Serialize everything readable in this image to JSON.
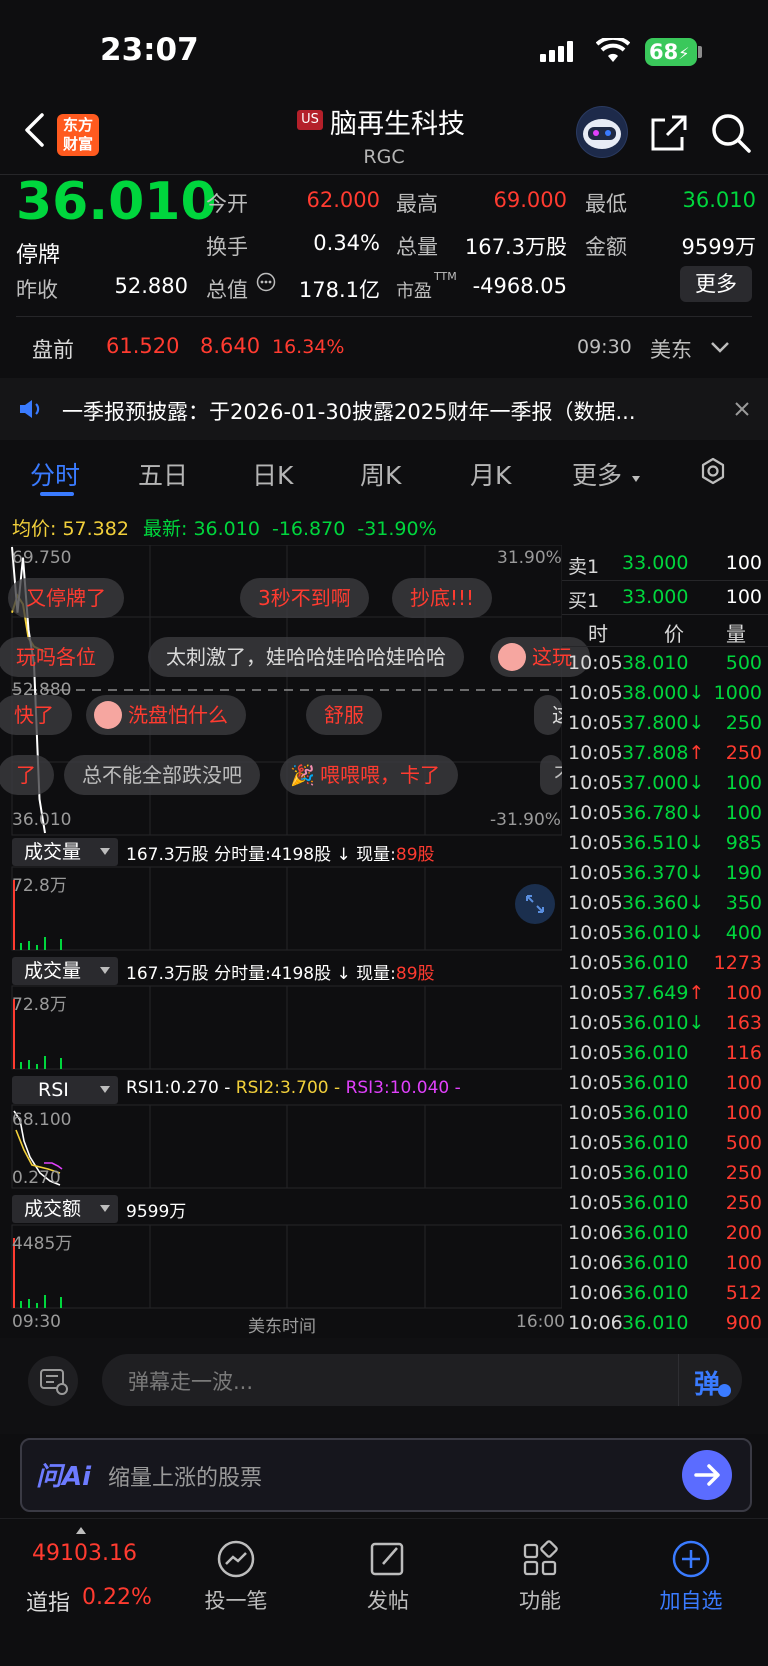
{
  "status_bar": {
    "time": "23:07",
    "battery": "68"
  },
  "header": {
    "market_badge": "US",
    "stock_name": "脑再生科技",
    "ticker": "RGC",
    "logo_text": "东方财富"
  },
  "quote": {
    "price": "36.010",
    "status": "停牌",
    "open_label": "今开",
    "open": "62.000",
    "high_label": "最高",
    "high": "69.000",
    "low_label": "最低",
    "low": "36.010",
    "turnover_label": "换手",
    "turnover": "0.34%",
    "volume_label": "总量",
    "volume": "167.3万股",
    "amount_label": "金额",
    "amount": "9599万",
    "prev_close_label": "昨收",
    "prev_close": "52.880",
    "mkt_cap_label": "总值",
    "mkt_cap": "178.1亿",
    "pe_label": "市盈",
    "pe_sup": "TTM",
    "pe": "-4968.05",
    "more_button": "更多"
  },
  "premarket": {
    "label": "盘前",
    "price": "61.520",
    "change": "8.640",
    "pct": "16.34%",
    "time": "09:30",
    "zone": "美东"
  },
  "notice": {
    "text": "一季报预披露：于2026-01-30披露2025财年一季报（数据..."
  },
  "tabs": [
    {
      "label": "分时"
    },
    {
      "label": "五日"
    },
    {
      "label": "日K"
    },
    {
      "label": "周K"
    },
    {
      "label": "月K"
    },
    {
      "label": "更多"
    }
  ],
  "chart": {
    "avg_label": "均价:",
    "avg": "57.382",
    "latest_label": "最新:",
    "latest": "36.010",
    "change": "-16.870",
    "pct": "-31.90%",
    "y_top": "69.750",
    "y_mid": "52.880",
    "y_bot": "36.010",
    "pct_top": "31.90%",
    "pct_bot": "-31.90%",
    "x_start": "09:30",
    "x_mid": "美东时间",
    "x_end": "16:00",
    "price_line": [
      [
        0,
        69.75
      ],
      [
        0.01,
        62.0
      ],
      [
        0.02,
        68.5
      ],
      [
        0.03,
        60.0
      ],
      [
        0.04,
        56.0
      ],
      [
        0.05,
        40.0
      ],
      [
        0.06,
        36.01
      ]
    ],
    "avg_line": [
      [
        0,
        62.0
      ],
      [
        0.01,
        64.0
      ],
      [
        0.02,
        63.0
      ],
      [
        0.03,
        59.0
      ],
      [
        0.04,
        58.0
      ],
      [
        0.06,
        57.382
      ]
    ]
  },
  "panels": {
    "vol1": {
      "selector": "成交量",
      "total": "167.3万股",
      "min_label": "分时量:",
      "min_vol": "4198股",
      "cur_label": "现量:",
      "cur_vol": "89股",
      "ymax": "72.8万"
    },
    "vol2": {
      "selector": "成交量",
      "total": "167.3万股",
      "min_label": "分时量:",
      "min_vol": "4198股",
      "cur_label": "现量:",
      "cur_vol": "89股",
      "ymax": "72.8万"
    },
    "rsi": {
      "selector": "RSI",
      "rsi1": "RSI1:0.270",
      "rsi2": "RSI2:3.700",
      "rsi3": "RSI3:10.040",
      "ymax": "68.100",
      "ymin": "0.270"
    },
    "amt": {
      "selector": "成交额",
      "total": "9599万",
      "ymax": "4485万"
    }
  },
  "danmaku": [
    {
      "text": "又停牌了"
    },
    {
      "text": "3秒不到啊"
    },
    {
      "text": "抄底!!!"
    },
    {
      "text": "玩吗各位"
    },
    {
      "text": "太刺激了，娃哈哈娃哈哈娃哈哈"
    },
    {
      "text": "这玩"
    },
    {
      "text": "快了"
    },
    {
      "text": "洗盘怕什么"
    },
    {
      "text": "舒服"
    },
    {
      "text": "这"
    },
    {
      "text": "了"
    },
    {
      "text": "总不能全部跌没吧"
    },
    {
      "text": "喂喂喂，卡了"
    },
    {
      "text": "不"
    }
  ],
  "orderbook": {
    "ask_label": "卖1",
    "ask_price": "33.000",
    "ask_vol": "100",
    "bid_label": "买1",
    "bid_price": "33.000",
    "bid_vol": "100",
    "col_time": "时",
    "col_price": "价",
    "col_vol": "量"
  },
  "ticks": [
    {
      "t": "10:05",
      "p": "38.010",
      "v": "500",
      "pc": "#00d63d",
      "vc": "#00d63d"
    },
    {
      "t": "10:05",
      "p": "38.000↓",
      "v": "1000",
      "pc": "#00d63d",
      "vc": "#00d63d"
    },
    {
      "t": "10:05",
      "p": "37.800↓",
      "v": "250",
      "pc": "#00d63d",
      "vc": "#00d63d"
    },
    {
      "t": "10:05",
      "p": "37.808↑",
      "v": "250",
      "pc": "#00d63d",
      "vc": "#ff3b30",
      "arrow": "red"
    },
    {
      "t": "10:05",
      "p": "37.000↓",
      "v": "100",
      "pc": "#00d63d",
      "vc": "#00d63d"
    },
    {
      "t": "10:05",
      "p": "36.780↓",
      "v": "100",
      "pc": "#00d63d",
      "vc": "#00d63d"
    },
    {
      "t": "10:05",
      "p": "36.510↓",
      "v": "985",
      "pc": "#00d63d",
      "vc": "#00d63d"
    },
    {
      "t": "10:05",
      "p": "36.370↓",
      "v": "190",
      "pc": "#00d63d",
      "vc": "#00d63d"
    },
    {
      "t": "10:05",
      "p": "36.360↓",
      "v": "350",
      "pc": "#00d63d",
      "vc": "#00d63d"
    },
    {
      "t": "10:05",
      "p": "36.010↓",
      "v": "400",
      "pc": "#00d63d",
      "vc": "#00d63d"
    },
    {
      "t": "10:05",
      "p": "36.010",
      "v": "1273",
      "pc": "#00d63d",
      "vc": "#ff3b30"
    },
    {
      "t": "10:05",
      "p": "37.649↑",
      "v": "100",
      "pc": "#00d63d",
      "vc": "#ff3b30",
      "arrow": "red"
    },
    {
      "t": "10:05",
      "p": "36.010↓",
      "v": "163",
      "pc": "#00d63d",
      "vc": "#ff3b30"
    },
    {
      "t": "10:05",
      "p": "36.010",
      "v": "116",
      "pc": "#00d63d",
      "vc": "#ff3b30"
    },
    {
      "t": "10:05",
      "p": "36.010",
      "v": "100",
      "pc": "#00d63d",
      "vc": "#ff3b30"
    },
    {
      "t": "10:05",
      "p": "36.010",
      "v": "100",
      "pc": "#00d63d",
      "vc": "#ff3b30"
    },
    {
      "t": "10:05",
      "p": "36.010",
      "v": "500",
      "pc": "#00d63d",
      "vc": "#ff3b30"
    },
    {
      "t": "10:05",
      "p": "36.010",
      "v": "250",
      "pc": "#00d63d",
      "vc": "#ff3b30"
    },
    {
      "t": "10:05",
      "p": "36.010",
      "v": "250",
      "pc": "#00d63d",
      "vc": "#ff3b30"
    },
    {
      "t": "10:06",
      "p": "36.010",
      "v": "200",
      "pc": "#00d63d",
      "vc": "#ff3b30"
    },
    {
      "t": "10:06",
      "p": "36.010",
      "v": "100",
      "pc": "#00d63d",
      "vc": "#ff3b30"
    },
    {
      "t": "10:06",
      "p": "36.010",
      "v": "512",
      "pc": "#00d63d",
      "vc": "#ff3b30"
    },
    {
      "t": "10:06",
      "p": "36.010",
      "v": "900",
      "pc": "#00d63d",
      "vc": "#ff3b30"
    }
  ],
  "input": {
    "placeholder": "弹幕走一波...",
    "send_label": "弹"
  },
  "askai": {
    "brand": "问Ai",
    "query": "缩量上涨的股票"
  },
  "bottom_nav": {
    "index_value": "49103.16",
    "index_name": "道指",
    "index_pct": "0.22%",
    "items": [
      {
        "label": "投一笔"
      },
      {
        "label": "发帖"
      },
      {
        "label": "功能"
      },
      {
        "label": "加自选"
      }
    ]
  },
  "colors": {
    "up": "#ff3b30",
    "down": "#00d63d",
    "accent": "#3a7bff",
    "avg_line": "#f2d03b"
  }
}
